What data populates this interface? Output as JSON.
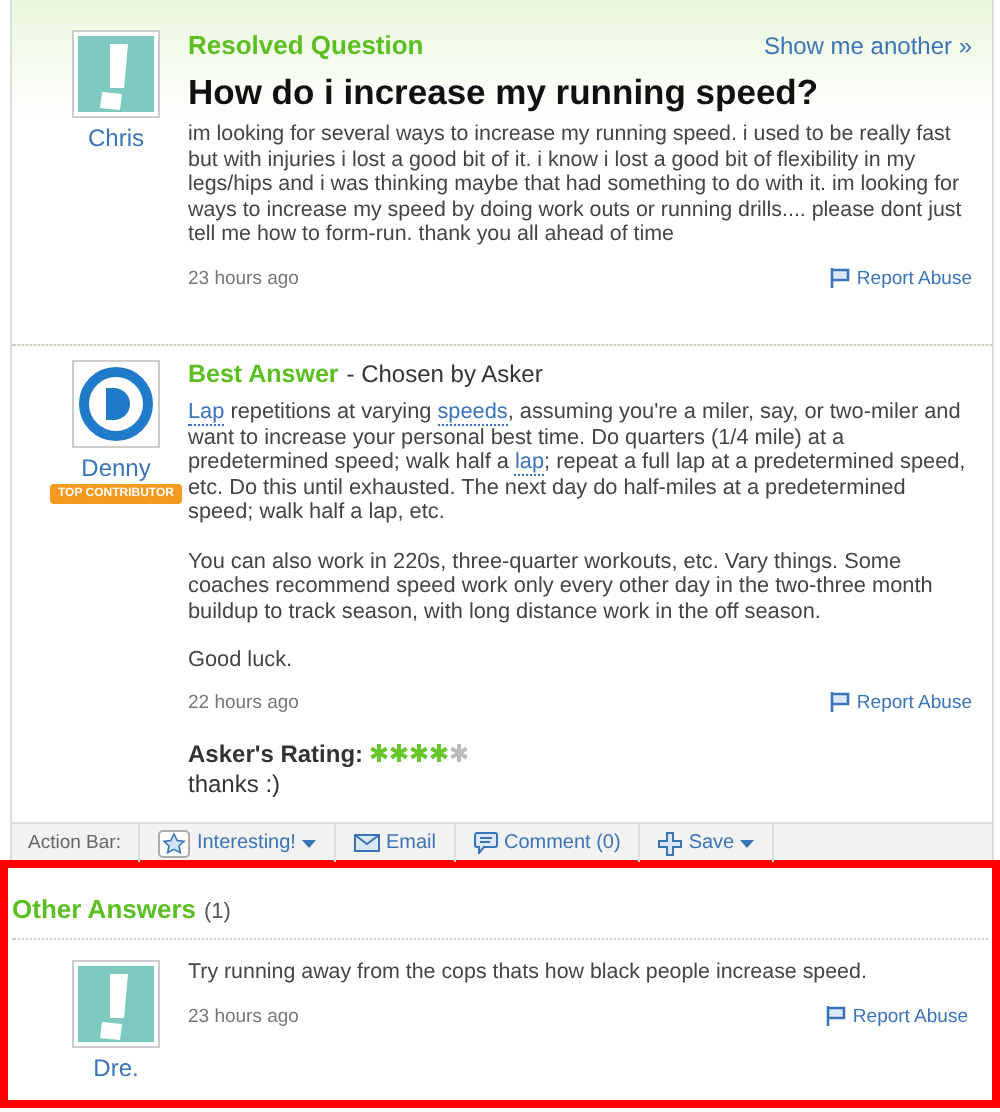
{
  "question": {
    "status": "Resolved Question",
    "show_another": "Show me another »",
    "title": "How do i increase my running speed?",
    "asker": "Chris",
    "body": "im looking for several ways to increase my running speed. i used to be really fast but with injuries i lost a good bit of it. i know i lost a good bit of flexibility in my legs/hips and i was thinking maybe that had something to do with it. im looking for ways to increase my speed by doing work outs or running drills.... please dont just tell me how to form-run. thank you all ahead of time",
    "time": "23 hours ago",
    "report": "Report Abuse"
  },
  "best_answer": {
    "heading": "Best Answer",
    "chosen_by": "- Chosen by Asker",
    "user": "Denny",
    "badge": "TOP CONTRIBUTOR",
    "paragraphs": [
      [
        {
          "text": "Lap",
          "link": true
        },
        {
          "text": " repetitions at varying ",
          "link": false
        },
        {
          "text": "speeds",
          "link": true
        },
        {
          "text": ", assuming you're a miler, say, or two-miler and want to increase your personal best time. Do quarters (1/4 mile) at a predetermined speed; walk half a ",
          "link": false
        },
        {
          "text": "lap",
          "link": true
        },
        {
          "text": "; repeat a full lap at a predetermined speed, etc. Do this until exhausted. The next day do half-miles at a predetermined speed; walk half a lap, etc.",
          "link": false
        }
      ],
      [
        {
          "text": "You can also work in 220s, three-quarter workouts, etc. Vary things. Some coaches recommend speed work only every other day in the two-three month buildup to track season, with long distance work in the off season.",
          "link": false
        }
      ],
      [
        {
          "text": "Good luck.",
          "link": false
        }
      ]
    ],
    "time": "22 hours ago",
    "report": "Report Abuse",
    "rating_label": "Asker's Rating:",
    "stars": 4,
    "comment": "thanks :)"
  },
  "action_bar": {
    "label": "Action Bar:",
    "actions": [
      {
        "kind": "interesting",
        "label": "Interesting!"
      },
      {
        "kind": "email",
        "label": "Email"
      },
      {
        "kind": "comment",
        "label": "Comment (0)"
      },
      {
        "kind": "save",
        "label": "Save"
      }
    ]
  },
  "other_answers": {
    "heading": "Other Answers",
    "count": "(1)",
    "answers": [
      {
        "user": "Dre.",
        "text": "Try running away from the cops thats how black people increase speed.",
        "time": "23 hours ago",
        "report": "Report Abuse"
      }
    ]
  }
}
